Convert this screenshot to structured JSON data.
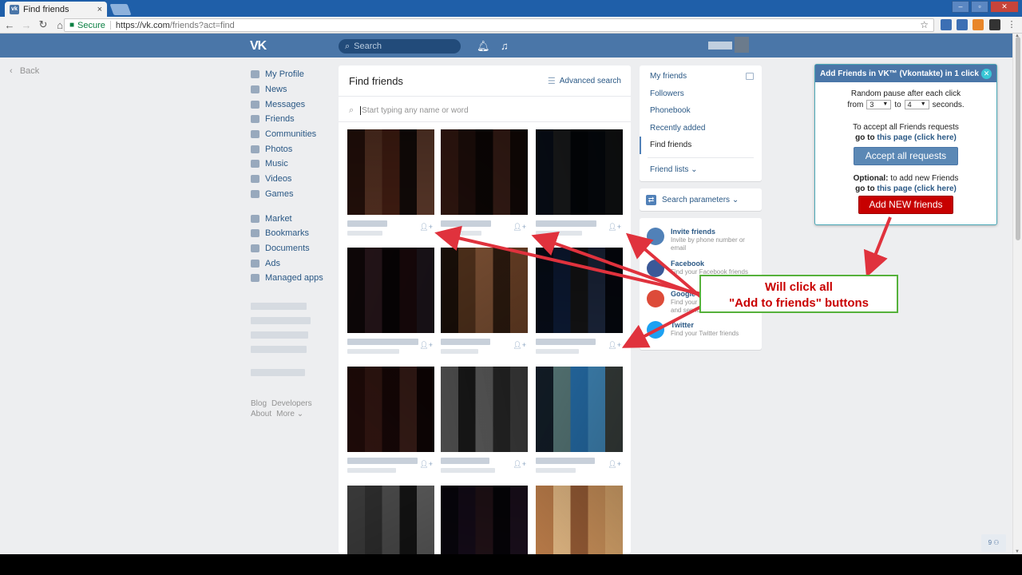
{
  "browser": {
    "tab_title": "Find friends",
    "tab_close": "×",
    "secure_label": "Secure",
    "url_host": "https://vk.com",
    "url_path": "/friends?act=find"
  },
  "vk_header": {
    "logo": "VK",
    "search_placeholder": "Search"
  },
  "back_label": "Back",
  "left_menu": [
    {
      "label": "My Profile",
      "icon": "home-icon"
    },
    {
      "label": "News",
      "icon": "news-icon"
    },
    {
      "label": "Messages",
      "icon": "messages-icon"
    },
    {
      "label": "Friends",
      "icon": "friends-icon"
    },
    {
      "label": "Communities",
      "icon": "communities-icon"
    },
    {
      "label": "Photos",
      "icon": "camera-icon"
    },
    {
      "label": "Music",
      "icon": "music-icon"
    },
    {
      "label": "Videos",
      "icon": "video-icon"
    },
    {
      "label": "Games",
      "icon": "gamepad-icon"
    }
  ],
  "left_menu2": [
    {
      "label": "Market",
      "icon": "market-icon"
    },
    {
      "label": "Bookmarks",
      "icon": "bookmark-icon"
    },
    {
      "label": "Documents",
      "icon": "document-icon"
    },
    {
      "label": "Ads",
      "icon": "ads-icon"
    },
    {
      "label": "Managed apps",
      "icon": "apps-icon"
    }
  ],
  "footer_links": {
    "blog": "Blog",
    "developers": "Developers",
    "about": "About",
    "more": "More ⌄"
  },
  "main": {
    "title": "Find friends",
    "advanced_search": "Advanced search",
    "search_placeholder": "Start typing any name or word"
  },
  "right_nav": {
    "items": [
      "My friends",
      "Followers",
      "Phonebook",
      "Recently added",
      "Find friends"
    ],
    "selected": "Find friends",
    "friend_lists": "Friend lists ⌄",
    "search_params": "Search parameters ⌄"
  },
  "invite": [
    {
      "title": "Invite friends",
      "sub": "Invite by phone number or email",
      "color": "#5181b8",
      "icon": "phone-icon"
    },
    {
      "title": "Facebook",
      "sub": "Find your Facebook friends",
      "color": "#3b5998",
      "icon": "facebook-icon"
    },
    {
      "title": "Google",
      "sub": "Find your Google friends and services",
      "color": "#dd4b39",
      "icon": "google-icon"
    },
    {
      "title": "Twitter",
      "sub": "Find your Twitter friends",
      "color": "#1da1f2",
      "icon": "twitter-icon"
    }
  ],
  "extension": {
    "title": "Add Friends in VK™ (Vkontakte) in 1 click",
    "pause_line": "Random pause after each click",
    "from": "from",
    "from_value": "3",
    "to": "to",
    "to_value": "4",
    "seconds": "seconds.",
    "accept_line": "To accept all Friends requests",
    "goto": "go to",
    "this_page": "this page",
    "click_here": "(click here)",
    "accept_button": "Accept all requests",
    "optional_label": "Optional:",
    "optional_line": "to add new Friends",
    "add_button": "Add NEW friends",
    "button_accept_color": "#5b88b5",
    "button_add_color": "#c70000"
  },
  "callout": {
    "line1": "Will click all",
    "line2": "\"Add to friends\" buttons"
  },
  "chat_badge": "9 ⚇",
  "colors": {
    "vk_blue": "#4a76a8",
    "arrow_red": "#e0323d",
    "callout_border": "#55b13b"
  }
}
